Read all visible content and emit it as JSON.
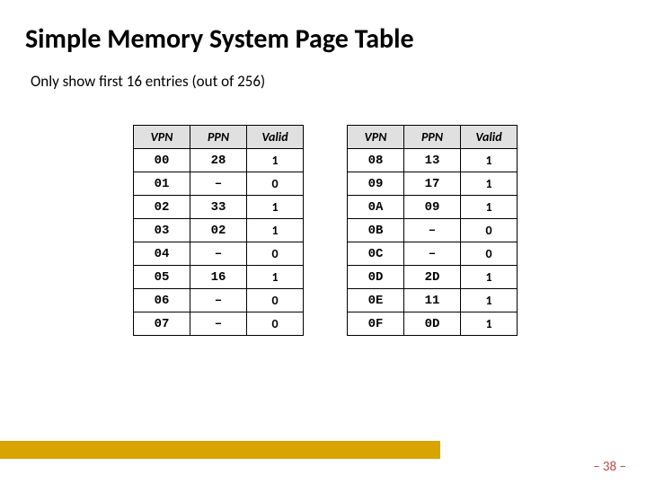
{
  "title": "Simple Memory System Page Table",
  "subtitle": "Only show first 16 entries (out of 256)",
  "headers": {
    "vpn": "VPN",
    "ppn": "PPN",
    "valid": "Valid"
  },
  "left": [
    {
      "vpn": "00",
      "ppn": "28",
      "valid": "1"
    },
    {
      "vpn": "01",
      "ppn": "–",
      "valid": "0"
    },
    {
      "vpn": "02",
      "ppn": "33",
      "valid": "1"
    },
    {
      "vpn": "03",
      "ppn": "02",
      "valid": "1"
    },
    {
      "vpn": "04",
      "ppn": "–",
      "valid": "0"
    },
    {
      "vpn": "05",
      "ppn": "16",
      "valid": "1"
    },
    {
      "vpn": "06",
      "ppn": "–",
      "valid": "0"
    },
    {
      "vpn": "07",
      "ppn": "–",
      "valid": "0"
    }
  ],
  "right": [
    {
      "vpn": "08",
      "ppn": "13",
      "valid": "1"
    },
    {
      "vpn": "09",
      "ppn": "17",
      "valid": "1"
    },
    {
      "vpn": "0A",
      "ppn": "09",
      "valid": "1"
    },
    {
      "vpn": "0B",
      "ppn": "–",
      "valid": "0"
    },
    {
      "vpn": "0C",
      "ppn": "–",
      "valid": "0"
    },
    {
      "vpn": "0D",
      "ppn": "2D",
      "valid": "1"
    },
    {
      "vpn": "0E",
      "ppn": "11",
      "valid": "1"
    },
    {
      "vpn": "0F",
      "ppn": "0D",
      "valid": "1"
    }
  ],
  "page_number": "– 38 –"
}
